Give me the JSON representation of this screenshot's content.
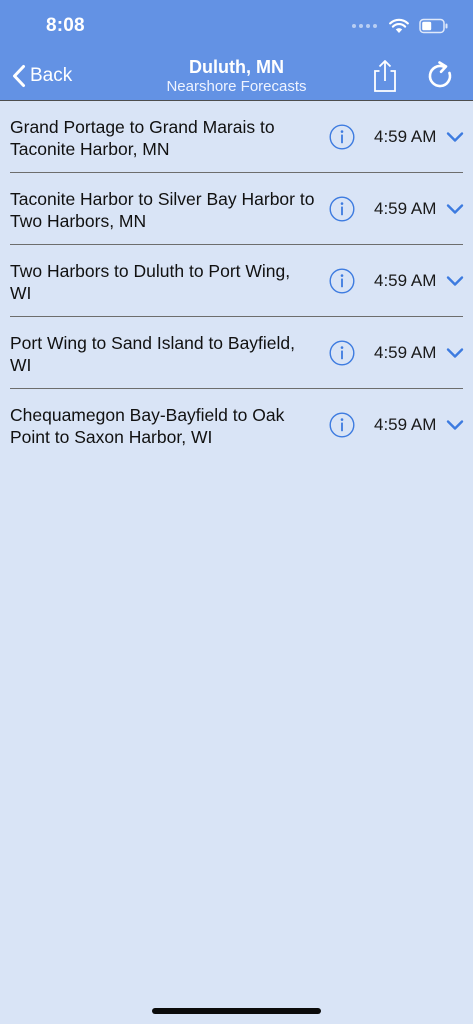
{
  "status_bar": {
    "time": "8:08"
  },
  "nav": {
    "back_label": "Back",
    "title": "Duluth, MN",
    "subtitle": "Nearshore Forecasts",
    "icons": {
      "back": "chevron-left-icon",
      "share": "share-icon",
      "refresh": "refresh-icon"
    }
  },
  "colors": {
    "header_bg": "#6392e4",
    "page_bg": "#d9e4f6",
    "accent": "#3d7be0"
  },
  "forecasts": [
    {
      "label": "Grand Portage to Grand Marais to Taconite Harbor, MN",
      "time": "4:59 AM"
    },
    {
      "label": "Taconite Harbor to Silver Bay Harbor to Two Harbors, MN",
      "time": "4:59 AM"
    },
    {
      "label": "Two Harbors to Duluth to Port Wing, WI",
      "time": "4:59 AM"
    },
    {
      "label": "Port Wing to Sand Island to Bayfield, WI",
      "time": "4:59 AM"
    },
    {
      "label": "Chequamegon Bay-Bayfield to Oak Point to Saxon Harbor, WI",
      "time": "4:59 AM"
    }
  ]
}
